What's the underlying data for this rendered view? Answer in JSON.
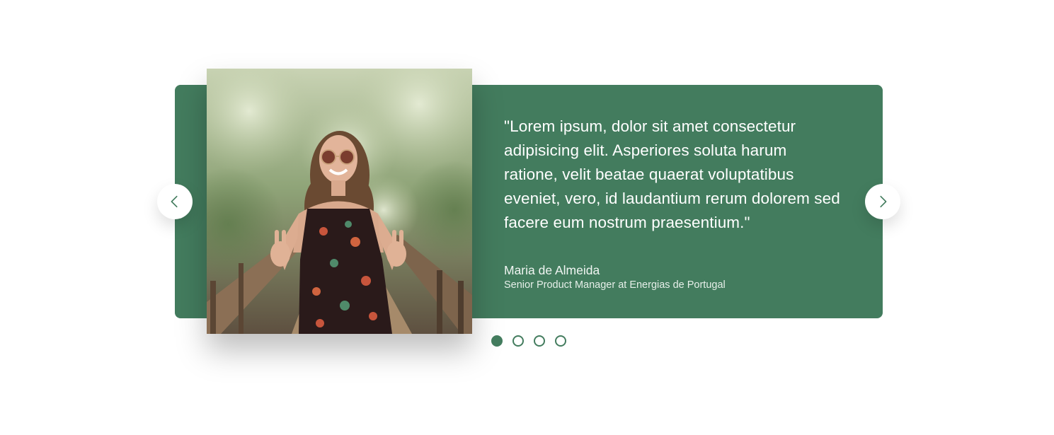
{
  "testimonial": {
    "quote": "\"Lorem ipsum, dolor sit amet consectetur adipisicing elit. Asperiores soluta harum ratione, velit beatae quaerat voluptatibus eveniet, vero, id laudantium rerum dolorem sed facere eum nostrum praesentium.\"",
    "author_name": "Maria de Almeida",
    "author_role": "Senior Product Manager at Energias de Portugal"
  },
  "navigation": {
    "prev_icon": "chevron-left-icon",
    "next_icon": "chevron-right-icon"
  },
  "pagination": {
    "count": 4,
    "active_index": 0
  },
  "colors": {
    "accent": "#437c5e",
    "background": "#ffffff",
    "text_on_accent": "#ffffff"
  }
}
